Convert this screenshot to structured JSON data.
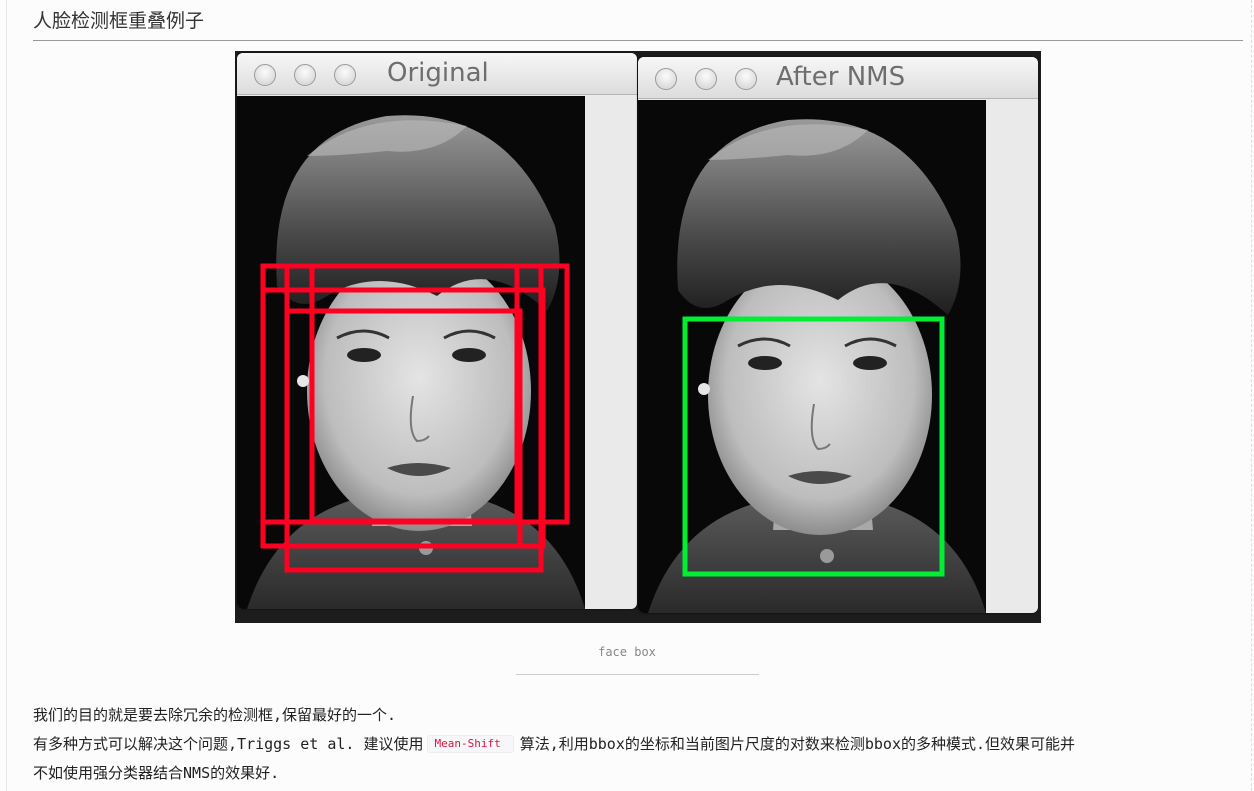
{
  "heading": "人脸检测框重叠例子",
  "figure": {
    "left_window": {
      "title": "Original",
      "box_color": "#ff0022"
    },
    "right_window": {
      "title": "After NMS",
      "box_color": "#00ee33"
    },
    "caption": "face box"
  },
  "paragraph": {
    "line1": "我们的目的就是要去除冗余的检测框,保留最好的一个.",
    "line2_before": "有多种方式可以解决这个问题,Triggs et al. 建议使用",
    "line2_code": "Mean-Shift",
    "line2_after": "算法,利用bbox的坐标和当前图片尺度的对数来检测bbox的多种模式.但效果可能并",
    "line3": "不如使用强分类器结合NMS的效果好."
  }
}
